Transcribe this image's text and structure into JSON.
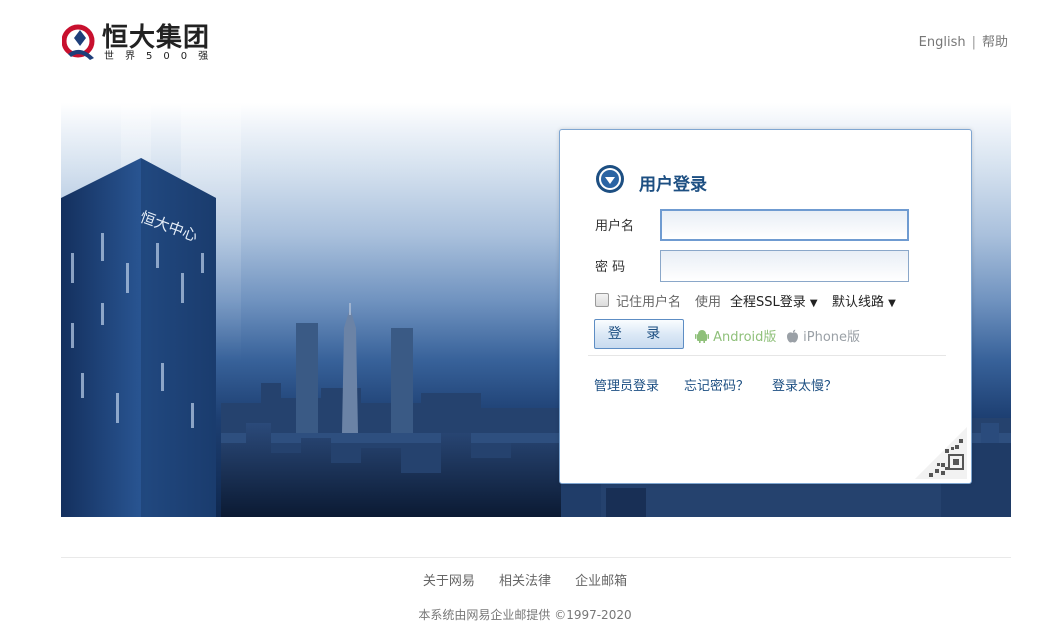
{
  "header": {
    "logo_title": "恒大集团",
    "logo_subtitle": "世界500强",
    "links": {
      "english": "English",
      "separator": "|",
      "help": "帮助"
    }
  },
  "banner": {
    "tower_sign": "恒大中心"
  },
  "login": {
    "title": "用户登录",
    "username_label": "用户名",
    "password_label": "密 码",
    "remember_label": "记住用户名",
    "use_label": "使用",
    "ssl_option": "全程SSL登录",
    "route_option": "默认线路",
    "login_button": "登 录",
    "android_label": "Android版",
    "iphone_label": "iPhone版",
    "admin_link": "管理员登录",
    "forgot_link": "忘记密码？",
    "slow_link": "登录太慢？",
    "username_value": "",
    "password_value": ""
  },
  "footer": {
    "links": [
      "关于网易",
      "相关法律",
      "企业邮箱"
    ],
    "copyright": "本系统由网易企业邮提供 ©1997-2020"
  },
  "colors": {
    "accent": "#1d4f82",
    "brand_red": "#c8102e",
    "android_green": "#8fc07a"
  }
}
